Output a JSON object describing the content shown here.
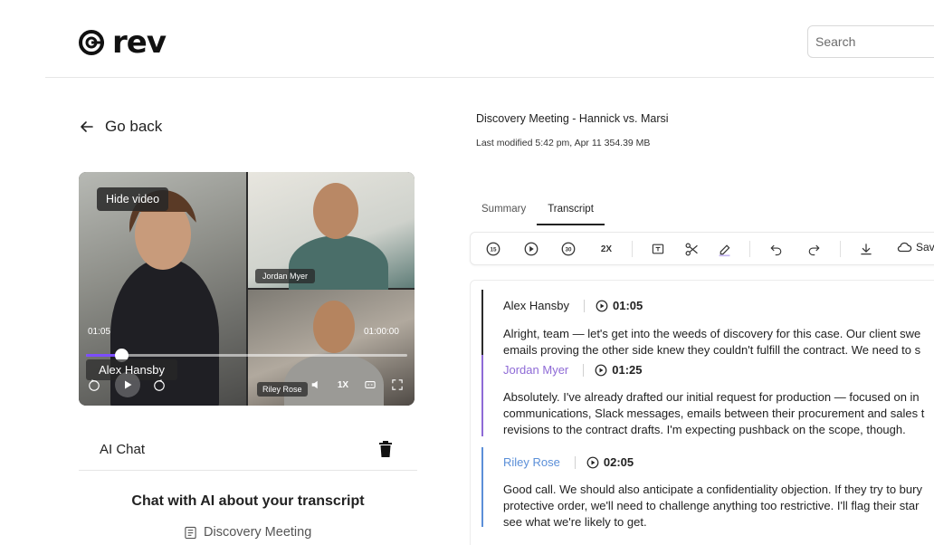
{
  "header": {
    "brand": "rev",
    "search_placeholder": "Search"
  },
  "left": {
    "go_back": "Go back",
    "video": {
      "hide_video": "Hide video",
      "current_time": "01:05",
      "total_time": "01:00:00",
      "progress": 0.11,
      "speed": "1X",
      "participants": {
        "main": "Alex Hansby",
        "top_right": "Jordan Myer",
        "bottom_right": "Riley Rose"
      }
    },
    "ai_chat": {
      "label": "AI Chat",
      "heading": "Chat with AI about your transcript",
      "doc_ref": "Discovery Meeting"
    }
  },
  "right": {
    "title": "Discovery Meeting - Hannick vs. Marsi",
    "meta": "Last modified 5:42 pm, Apr 11 354.39 MB",
    "tabs": [
      {
        "label": "Summary",
        "active": false
      },
      {
        "label": "Transcript",
        "active": true
      }
    ],
    "toolbar": {
      "speed": "2X",
      "save": "Save"
    },
    "segments": [
      {
        "speaker": "Alex Hansby",
        "time": "01:05",
        "color": "#2b2b2b",
        "speaker_color": "#222222",
        "lines": [
          "Alright, team — let's get into the weeds of discovery for this case. Our client swe",
          "emails proving the other side knew they couldn't fulfill the contract. We need to s"
        ]
      },
      {
        "speaker": "Jordan Myer",
        "time": "01:25",
        "color": "#8e6ad6",
        "speaker_color": "#8e6ad6",
        "lines": [
          "Absolutely. I've already drafted our initial request for production — focused on in",
          "communications, Slack messages, emails between their procurement and sales t",
          "revisions to the contract drafts. I'm expecting pushback on the scope, though."
        ]
      },
      {
        "speaker": "Riley Rose",
        "time": "02:05",
        "color": "#5b8fd8",
        "speaker_color": "#5b8fd8",
        "lines": [
          "Good call. We should also anticipate a confidentiality objection. If they try to bury",
          "protective order, we'll need to challenge anything too restrictive. I'll flag their star",
          "see what we're likely to get."
        ]
      }
    ]
  }
}
